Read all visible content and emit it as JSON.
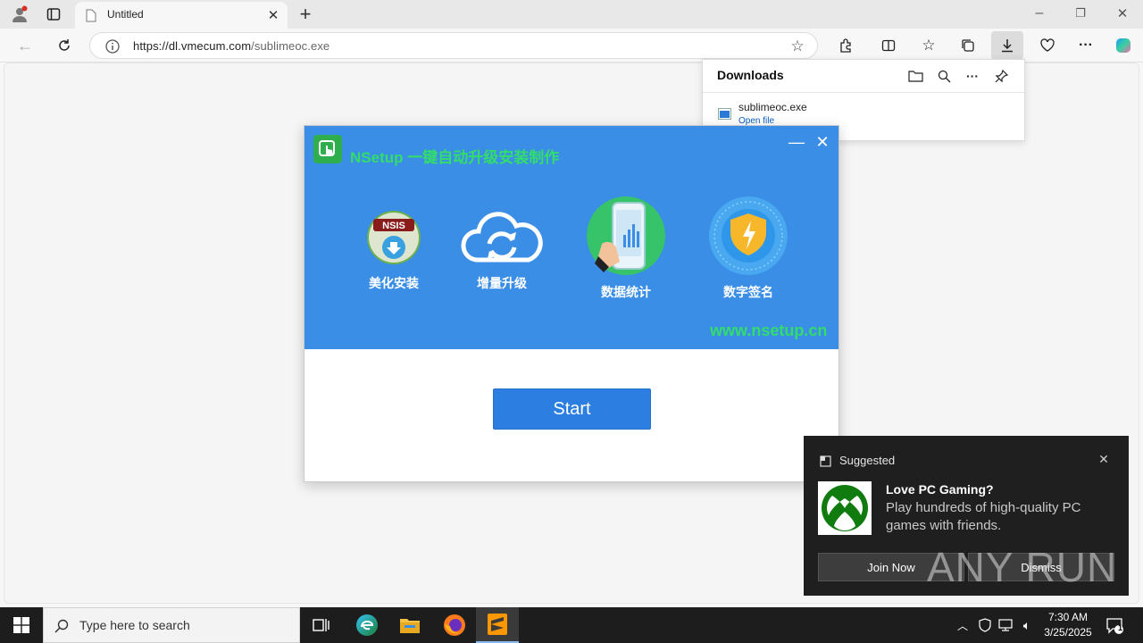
{
  "browser": {
    "tab_title": "Untitled",
    "address_domain": "https://dl.vmecum.com",
    "address_path": "/sublimeoc.exe"
  },
  "downloads": {
    "title": "Downloads",
    "file_name": "sublimeoc.exe",
    "open_label": "Open file"
  },
  "nsetup": {
    "title": "NSetup 一键自动升级安装制作",
    "features": [
      {
        "label": "美化安装",
        "icon": "nsis-icon"
      },
      {
        "label": "增量升级",
        "icon": "cloud-sync-icon"
      },
      {
        "label": "数据统计",
        "icon": "phone-chart-icon"
      },
      {
        "label": "数字签名",
        "icon": "shield-lightning-icon"
      }
    ],
    "url": "www.nsetup.cn",
    "start_label": "Start"
  },
  "notification": {
    "category": "Suggested",
    "headline": "Love PC Gaming?",
    "body": "Play hundreds of high-quality PC games with friends.",
    "join_label": "Join Now",
    "dismiss_label": "Dismiss"
  },
  "taskbar": {
    "search_placeholder": "Type here to search",
    "time": "7:30 AM",
    "date": "3/25/2025",
    "notification_count": "1"
  },
  "watermark": "ANY RUN",
  "colors": {
    "nsetup_blue": "#3a8ee6",
    "nsetup_green": "#33dd6b",
    "start_button": "#2c7fe0",
    "toast_bg": "#1f1f1f"
  }
}
